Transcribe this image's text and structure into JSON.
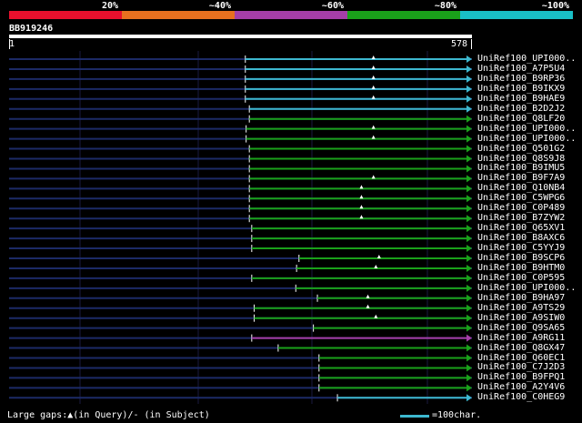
{
  "scale": {
    "labels": [
      "20%",
      "~40%",
      "~60%",
      "~80%",
      "~100%"
    ],
    "colors": [
      "#e8102d",
      "#e8701f",
      "#a53ea8",
      "#1aa11a",
      "#19bfc6"
    ]
  },
  "query": {
    "id": "BB919246",
    "start": "1",
    "end": "578"
  },
  "hits": [
    {
      "label": "UniRef100_UPI000..",
      "start": 295,
      "end": 578,
      "color": "#3db8cf"
    },
    {
      "label": "UniRef100_A7P5U4",
      "start": 295,
      "end": 578,
      "color": "#3db8cf"
    },
    {
      "label": "UniRef100_B9RP36",
      "start": 295,
      "end": 578,
      "color": "#3db8cf"
    },
    {
      "label": "UniRef100_B9IKX9",
      "start": 295,
      "end": 578,
      "color": "#3db8cf"
    },
    {
      "label": "UniRef100_B9HAE9",
      "start": 295,
      "end": 578,
      "color": "#3db8cf"
    },
    {
      "label": "UniRef100_B2D2J2",
      "start": 300,
      "end": 578,
      "color": "#3db8cf"
    },
    {
      "label": "UniRef100_Q8LF20",
      "start": 300,
      "end": 578,
      "color": "#1aa11a"
    },
    {
      "label": "UniRef100_UPI000..",
      "start": 296,
      "end": 578,
      "color": "#1aa11a"
    },
    {
      "label": "UniRef100_UPI000..",
      "start": 296,
      "end": 578,
      "color": "#1aa11a"
    },
    {
      "label": "UniRef100_Q501G2",
      "start": 300,
      "end": 578,
      "color": "#1aa11a"
    },
    {
      "label": "UniRef100_Q8S9J8",
      "start": 300,
      "end": 578,
      "color": "#1aa11a"
    },
    {
      "label": "UniRef100_B9IMU5",
      "start": 300,
      "end": 578,
      "color": "#1aa11a"
    },
    {
      "label": "UniRef100_B9F7A9",
      "start": 300,
      "end": 578,
      "color": "#1aa11a"
    },
    {
      "label": "UniRef100_Q10NB4",
      "start": 300,
      "end": 578,
      "color": "#1aa11a"
    },
    {
      "label": "UniRef100_C5WPG6",
      "start": 300,
      "end": 578,
      "color": "#1aa11a"
    },
    {
      "label": "UniRef100_C0P489",
      "start": 300,
      "end": 578,
      "color": "#1aa11a"
    },
    {
      "label": "UniRef100_B7ZYW2",
      "start": 300,
      "end": 578,
      "color": "#1aa11a"
    },
    {
      "label": "UniRef100_Q65XV1",
      "start": 303,
      "end": 578,
      "color": "#1aa11a"
    },
    {
      "label": "UniRef100_B8AXC6",
      "start": 303,
      "end": 578,
      "color": "#1aa11a"
    },
    {
      "label": "UniRef100_C5YYJ9",
      "start": 303,
      "end": 578,
      "color": "#1aa11a"
    },
    {
      "label": "UniRef100_B9SCP6",
      "start": 362,
      "end": 578,
      "color": "#1aa11a"
    },
    {
      "label": "UniRef100_B9HTM0",
      "start": 359,
      "end": 578,
      "color": "#1aa11a"
    },
    {
      "label": "UniRef100_C0P595",
      "start": 303,
      "end": 578,
      "color": "#1aa11a"
    },
    {
      "label": "UniRef100_UPI000..",
      "start": 358,
      "end": 578,
      "color": "#1aa11a"
    },
    {
      "label": "UniRef100_B9HA97",
      "start": 385,
      "end": 578,
      "color": "#1aa11a"
    },
    {
      "label": "UniRef100_A9TS29",
      "start": 306,
      "end": 578,
      "color": "#1aa11a"
    },
    {
      "label": "UniRef100_A9SIW0",
      "start": 306,
      "end": 578,
      "color": "#1aa11a"
    },
    {
      "label": "UniRef100_Q9SA65",
      "start": 380,
      "end": 578,
      "color": "#1aa11a"
    },
    {
      "label": "UniRef100_A9RG11",
      "start": 303,
      "end": 578,
      "color": "#a53ea8"
    },
    {
      "label": "UniRef100_Q8GX47",
      "start": 336,
      "end": 578,
      "color": "#1aa11a"
    },
    {
      "label": "UniRef100_Q60EC1",
      "start": 387,
      "end": 578,
      "color": "#1aa11a"
    },
    {
      "label": "UniRef100_C7J2D3",
      "start": 387,
      "end": 578,
      "color": "#1aa11a"
    },
    {
      "label": "UniRef100_B9FPQ1",
      "start": 387,
      "end": 578,
      "color": "#1aa11a"
    },
    {
      "label": "UniRef100_A2Y4V6",
      "start": 387,
      "end": 578,
      "color": "#1aa11a"
    },
    {
      "label": "UniRef100_C0HEG9",
      "start": 410,
      "end": 578,
      "color": "#3db8cf"
    }
  ],
  "legend": {
    "gaps_text": "Large gaps:▲(in Query)/- (in Subject)",
    "scale_text": "=100char.",
    "scale_color": "#3db8cf"
  }
}
